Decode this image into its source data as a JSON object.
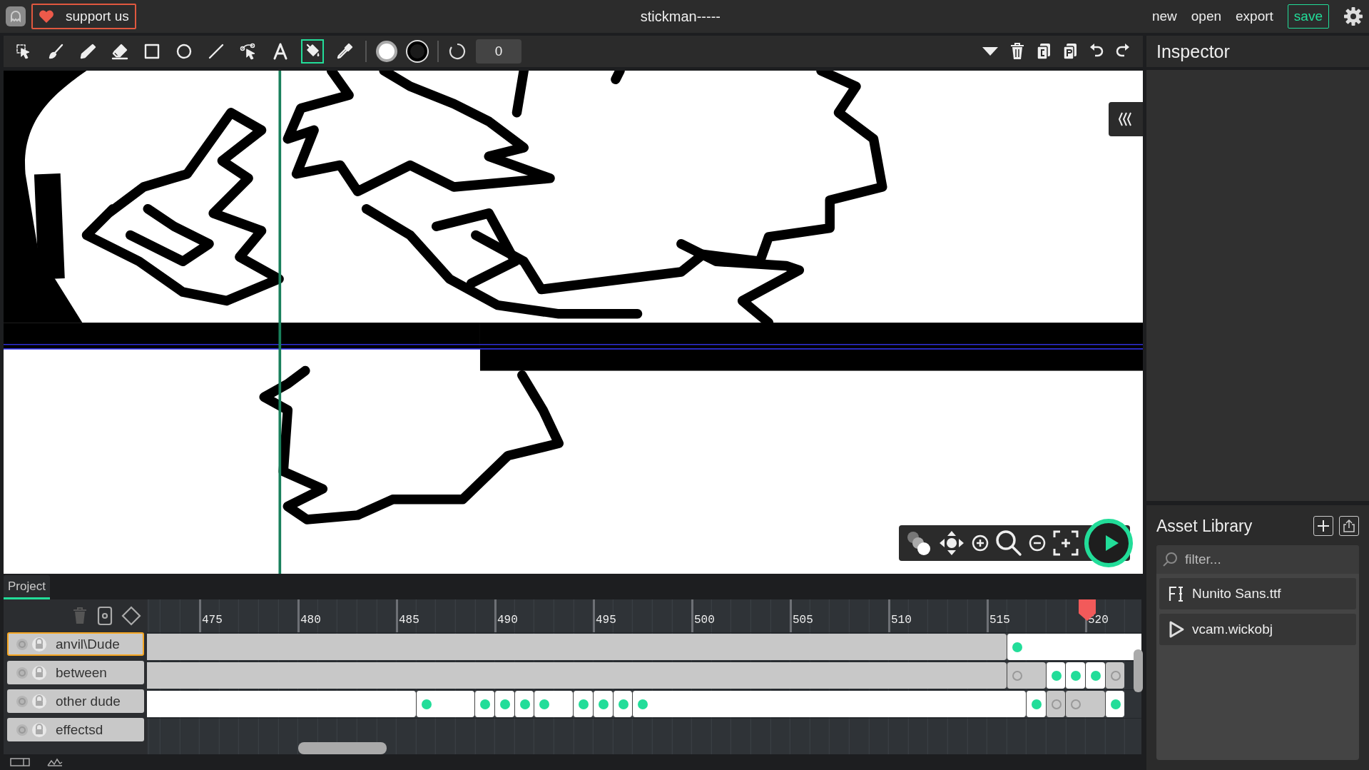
{
  "topbar": {
    "support_label": "support us",
    "title": "stickman-----",
    "menu": [
      {
        "label": "new"
      },
      {
        "label": "open"
      },
      {
        "label": "export"
      }
    ],
    "save_label": "save"
  },
  "toolbar": {
    "tools": [
      {
        "kind": "select",
        "selected": false
      },
      {
        "kind": "brush",
        "selected": false
      },
      {
        "kind": "pencil",
        "selected": false
      },
      {
        "kind": "eraser",
        "selected": false
      },
      {
        "kind": "rectangle",
        "selected": false
      },
      {
        "kind": "ellipse",
        "selected": false
      },
      {
        "kind": "line",
        "selected": false
      },
      {
        "kind": "path",
        "selected": false
      },
      {
        "kind": "text",
        "selected": false
      },
      {
        "kind": "fill",
        "selected": true
      },
      {
        "kind": "eyedropper",
        "selected": false
      }
    ],
    "brush_size": "0"
  },
  "inspector": {
    "title": "Inspector"
  },
  "asset_library": {
    "title": "Asset Library",
    "filter_placeholder": "filter...",
    "assets": [
      {
        "kind": "font",
        "name": "Nunito Sans.ttf"
      },
      {
        "kind": "clip",
        "name": "vcam.wickobj"
      }
    ]
  },
  "timeline": {
    "tabs": [
      {
        "label": "Project",
        "selected": true
      }
    ],
    "ticks": [
      {
        "label": "475",
        "playhead": false
      },
      {
        "label": "480",
        "playhead": false
      },
      {
        "label": "485",
        "playhead": false
      },
      {
        "label": "490",
        "playhead": false
      },
      {
        "label": "495",
        "playhead": false
      },
      {
        "label": "500",
        "playhead": false
      },
      {
        "label": "505",
        "playhead": false
      },
      {
        "label": "510",
        "playhead": false
      },
      {
        "label": "515",
        "playhead": false
      },
      {
        "label": "520",
        "playhead": true
      }
    ],
    "layers": [
      {
        "name": "anvil\\Dude",
        "selected": true,
        "frames": [
          {
            "shaded": true
          },
          {
            "shaded": false,
            "filled": true
          }
        ]
      },
      {
        "name": "between",
        "selected": false,
        "frames": [
          {
            "shaded": true
          },
          {
            "shaded": true,
            "filled": false
          },
          {
            "shaded": false,
            "filled": true
          },
          {
            "shaded": false,
            "filled": true
          },
          {
            "shaded": false,
            "filled": true
          },
          {
            "shaded": true,
            "filled": false
          }
        ]
      },
      {
        "name": "other dude",
        "selected": false,
        "frames": [
          {
            "shaded": false
          },
          {
            "shaded": false,
            "filled": true
          },
          {
            "shaded": false,
            "filled": true
          },
          {
            "shaded": false,
            "filled": true
          },
          {
            "shaded": false,
            "filled": true
          },
          {
            "shaded": false,
            "filled": true
          },
          {
            "shaded": false,
            "filled": true
          },
          {
            "shaded": false,
            "filled": true
          },
          {
            "shaded": false,
            "filled": true
          },
          {
            "shaded": false,
            "filled": true
          },
          {
            "shaded": false,
            "filled": true
          },
          {
            "shaded": true,
            "filled": false
          },
          {
            "shaded": true,
            "filled": false
          },
          {
            "shaded": false,
            "filled": true
          }
        ]
      },
      {
        "name": "effectsd",
        "selected": false
      }
    ]
  }
}
